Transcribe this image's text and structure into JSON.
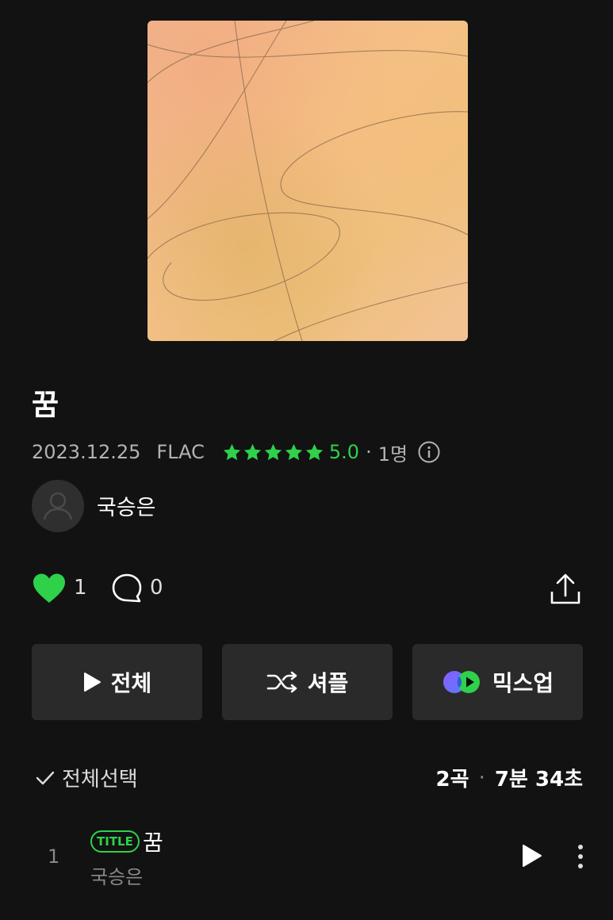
{
  "album": {
    "title": "꿈",
    "release_date": "2023.12.25",
    "format": "FLAC",
    "rating_value": "5.0",
    "rating_count": "1명",
    "stars": 5
  },
  "artist": {
    "name": "국승은"
  },
  "social": {
    "likes": "1",
    "comments": "0"
  },
  "actions": {
    "play_all": "전체",
    "shuffle": "셔플",
    "mixup": "믹스업"
  },
  "tracklist": {
    "select_all": "전체선택",
    "track_count": "2곡",
    "duration": "7분 34초",
    "separator": "·"
  },
  "tracks": [
    {
      "number": "1",
      "badge": "TITLE",
      "title": "꿈",
      "artist": "국승은"
    }
  ],
  "colors": {
    "accent": "#2fd14b",
    "background": "#121212",
    "button": "#2a2a2a"
  }
}
